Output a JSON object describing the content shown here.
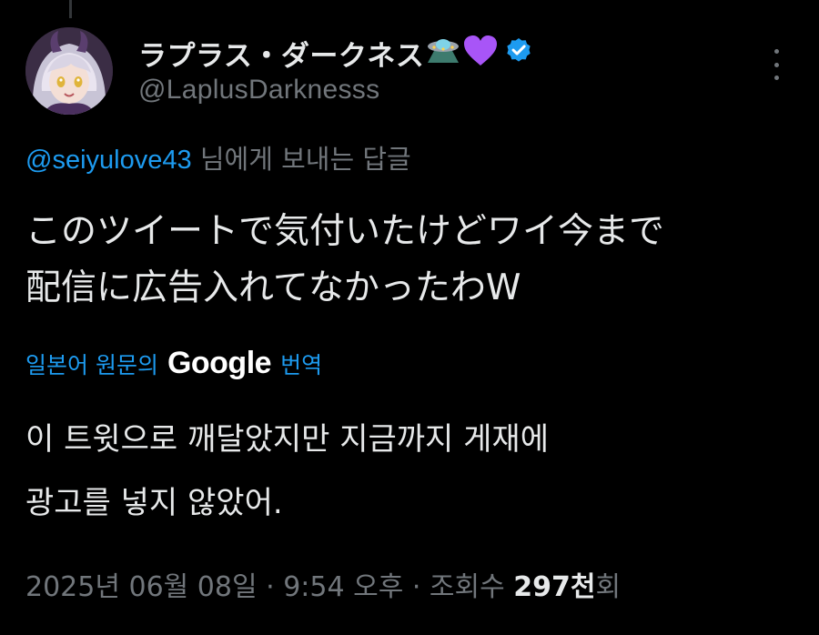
{
  "author": {
    "display_name": "ラプラス・ダークネス",
    "emojis": [
      "ufo-emoji",
      "purple-heart-emoji"
    ],
    "verified_icon": "verified-badge-icon",
    "handle": "@LaplusDarknesss",
    "avatar_icon": "avatar-image"
  },
  "reply_context": {
    "mention": "@seiyulove43",
    "suffix": " 님에게 보내는 답글"
  },
  "tweet": {
    "text": "このツイートで気付いたけどワイ今まで\n配信に広告入れてなかったわW"
  },
  "translation": {
    "prefix": "일본어 원문의",
    "provider": "Google",
    "suffix": "번역",
    "text": "이 트윗으로 깨달았지만 지금까지 게재에\n광고를 넣지 않았어."
  },
  "meta": {
    "date": "2025년 06월 08일",
    "time": "9:54 오후",
    "views_label": "조회수",
    "views_count": "297천",
    "views_suffix": "회",
    "separator": " · "
  },
  "more_icon": "more-vertical-icon",
  "colors": {
    "background": "#000000",
    "text": "#e7e9ea",
    "muted": "#71767b",
    "accent": "#1d9bf0",
    "verified": "#1d9bf0",
    "heart": "#a855f7"
  }
}
